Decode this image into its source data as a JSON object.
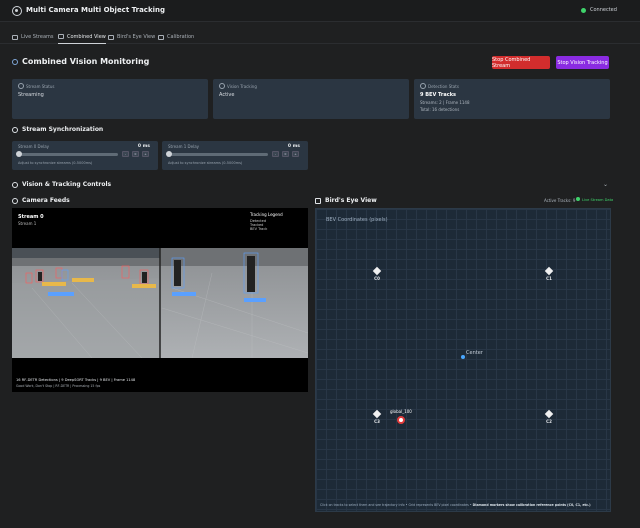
{
  "app": {
    "title": "Multi Camera Multi Object Tracking",
    "connection": "Connected"
  },
  "tabs": [
    {
      "label": "Live Streams"
    },
    {
      "label": "Combined View"
    },
    {
      "label": "Bird's Eye View"
    },
    {
      "label": "Calibration"
    }
  ],
  "header": {
    "title": "Combined Vision Monitoring",
    "stop_stream": "Stop Combined Stream",
    "stop_tracking": "Stop Vision Tracking"
  },
  "stats": [
    {
      "label": "Stream Status",
      "value": "Streaming"
    },
    {
      "label": "Vision Tracking",
      "value": "Active"
    },
    {
      "label": "Detection Stats",
      "value": "9 BEV Tracks",
      "sub1": "Streams: 2 | Frame 1148",
      "sub2": "Total: 16 detections"
    }
  ],
  "sync": {
    "title": "Stream Synchronization",
    "streams": [
      {
        "label": "Stream 0 Delay",
        "value": "0 ms",
        "help": "Adjust to synchronize streams (0-5000ms)"
      },
      {
        "label": "Stream 1 Delay",
        "value": "0 ms",
        "help": "Adjust to synchronize streams (0-5000ms)"
      }
    ]
  },
  "controls_title": "Vision & Tracking Controls",
  "camera": {
    "title": "Camera Feeds",
    "overlay_title": "Stream 0",
    "overlay_sub": "Stream 1",
    "legend_title": "Tracking Legend",
    "legend_items": [
      "Detected",
      "Tracked",
      "BEV Track"
    ],
    "footer1": "16 RF-DETR Detections | 9 DeepSORT Tracks | 9 BEV | Frame 1148",
    "footer2": "Good Work, Don't Stop | RF-DETR | Processing 15 fps"
  },
  "bev": {
    "title": "Bird's Eye View",
    "active_tracks": "Active Tracks: 9",
    "live_status": "Live Stream Data",
    "coord_label": "BEV Coordinates (pixels)",
    "cameras": [
      "C0",
      "C1",
      "C3",
      "C2"
    ],
    "center_label": "Center",
    "track_label": "global_100",
    "footer_prefix": "Click on tracks to select them and see trajectory info • Grid represents BEV pixel coordinates •",
    "footer_bold": "Diamond markers show calibration reference points (C0, C1, etc.)"
  }
}
